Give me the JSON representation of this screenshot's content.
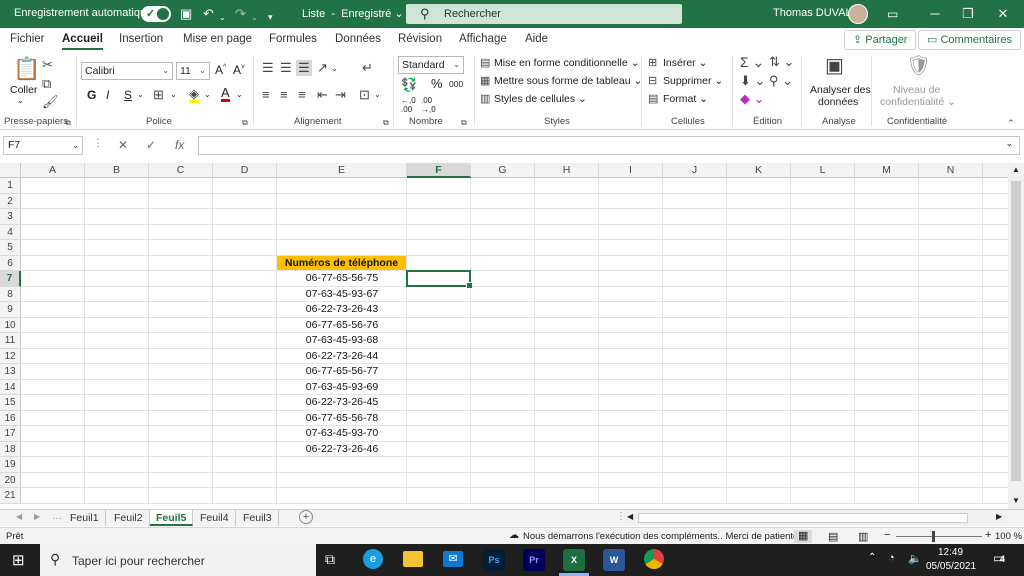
{
  "titlebar": {
    "autosave_label": "Enregistrement automatique",
    "doc_title": "Liste",
    "save_state": "Enregistré",
    "search_placeholder": "Rechercher",
    "user_name": "Thomas DUVAL"
  },
  "menu": {
    "tabs": [
      "Fichier",
      "Accueil",
      "Insertion",
      "Mise en page",
      "Formules",
      "Données",
      "Révision",
      "Affichage",
      "Aide"
    ],
    "active": "Accueil",
    "share_label": "Partager",
    "comments_label": "Commentaires"
  },
  "ribbon": {
    "clipboard": {
      "paste_label": "Coller",
      "group_label": "Presse-papiers"
    },
    "font": {
      "name": "Calibri",
      "size": "11",
      "bold": "G",
      "italic": "I",
      "underline": "S",
      "grow": "A^",
      "shrink": "A˅",
      "group_label": "Police"
    },
    "alignment": {
      "group_label": "Alignement"
    },
    "number": {
      "format": "Standard",
      "group_label": "Nombre",
      "percent": "%",
      "thousands": "000"
    },
    "styles": {
      "conditional": "Mise en forme conditionnelle",
      "table": "Mettre sous forme de tableau",
      "cell_styles": "Styles de cellules",
      "group_label": "Styles"
    },
    "cells": {
      "insert": "Insérer",
      "delete": "Supprimer",
      "format": "Format",
      "group_label": "Cellules"
    },
    "editing": {
      "group_label": "Édition"
    },
    "analysis": {
      "label_line1": "Analyser des",
      "label_line2": "données",
      "group_label": "Analyse"
    },
    "sensitivity": {
      "label_line1": "Niveau de",
      "label_line2": "confidentialité",
      "group_label": "Confidentialité"
    }
  },
  "formula_bar": {
    "name_box": "F7",
    "fx": "fx",
    "value": ""
  },
  "grid": {
    "columns": [
      "A",
      "B",
      "C",
      "D",
      "E",
      "F",
      "G",
      "H",
      "I",
      "J",
      "K",
      "L",
      "M",
      "N"
    ],
    "rows": [
      "1",
      "2",
      "3",
      "4",
      "5",
      "6",
      "7",
      "8",
      "9",
      "10",
      "11",
      "12",
      "13",
      "14",
      "15",
      "16",
      "17",
      "18",
      "19",
      "20",
      "21"
    ],
    "selected_col": "F",
    "selected_row": "7",
    "header_cell": "Numéros de téléphone",
    "phones": [
      "06-77-65-56-75",
      "07-63-45-93-67",
      "06-22-73-26-43",
      "06-77-65-56-76",
      "07-63-45-93-68",
      "06-22-73-26-44",
      "06-77-65-56-77",
      "07-63-45-93-69",
      "06-22-73-26-45",
      "06-77-65-56-78",
      "07-63-45-93-70",
      "06-22-73-26-46"
    ]
  },
  "sheets": {
    "names": [
      "Feuil1",
      "Feuil2",
      "Feuil5",
      "Feuil4",
      "Feuil3"
    ],
    "active": "Feuil5"
  },
  "status": {
    "ready": "Prêt",
    "message": "Nous démarrons l'exécution des compléments.. Merci de patienter.",
    "zoom": "100 %"
  },
  "taskbar": {
    "search_placeholder": "Taper ici pour rechercher",
    "time": "12:49",
    "date": "05/05/2021",
    "notifications": "4",
    "apps": [
      {
        "name": "Ps",
        "color": "#001e36",
        "fg": "#31a8ff"
      },
      {
        "name": "Pr",
        "color": "#00005b",
        "fg": "#9999ff"
      },
      {
        "name": "X",
        "color": "#1d6f42",
        "fg": "#ffffff"
      },
      {
        "name": "W",
        "color": "#2b579a",
        "fg": "#ffffff"
      }
    ]
  }
}
